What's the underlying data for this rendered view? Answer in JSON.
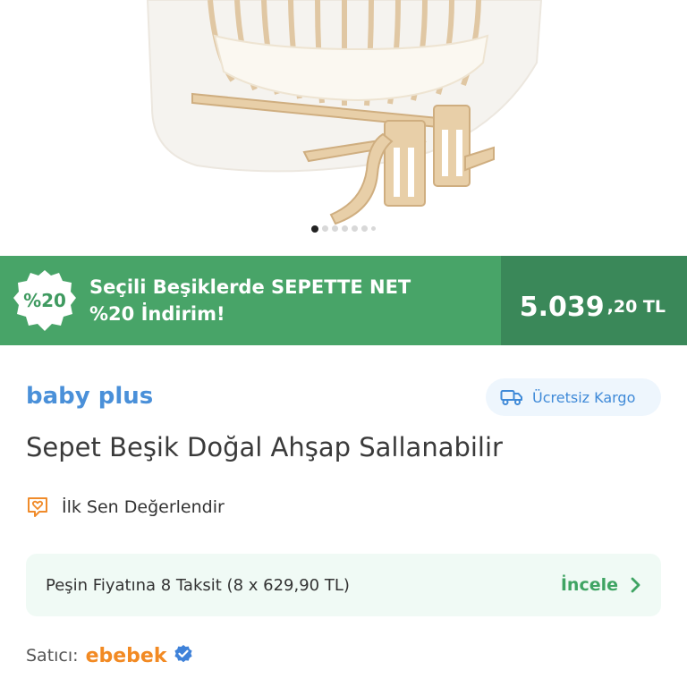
{
  "product_image": {
    "alt": "product-photo",
    "carousel": {
      "count": 7,
      "active_index": 0
    }
  },
  "promo": {
    "badge": "%20",
    "line1": "Seçili Beşiklerde SEPETTE NET",
    "line2": "%20 İndirim!",
    "price_int": "5.039",
    "price_dec": ",20 TL",
    "colors": {
      "left": "#48a468",
      "right": "#3a8859"
    }
  },
  "brand": "baby plus",
  "shipping_label": "Ücretsiz Kargo",
  "title": "Sepet Beşik Doğal Ahşap Sallanabilir",
  "review_label": "İlk Sen Değerlendir",
  "installment": {
    "text": "Peşin Fiyatına 8 Taksit (8 x 629,90 TL)",
    "action": "İncele"
  },
  "seller": {
    "label": "Satıcı:",
    "name": "ebebek"
  },
  "icons": [
    "truck-icon",
    "heart-chat-icon",
    "chevron-right-icon",
    "verified-badge-icon",
    "discount-badge-icon"
  ]
}
